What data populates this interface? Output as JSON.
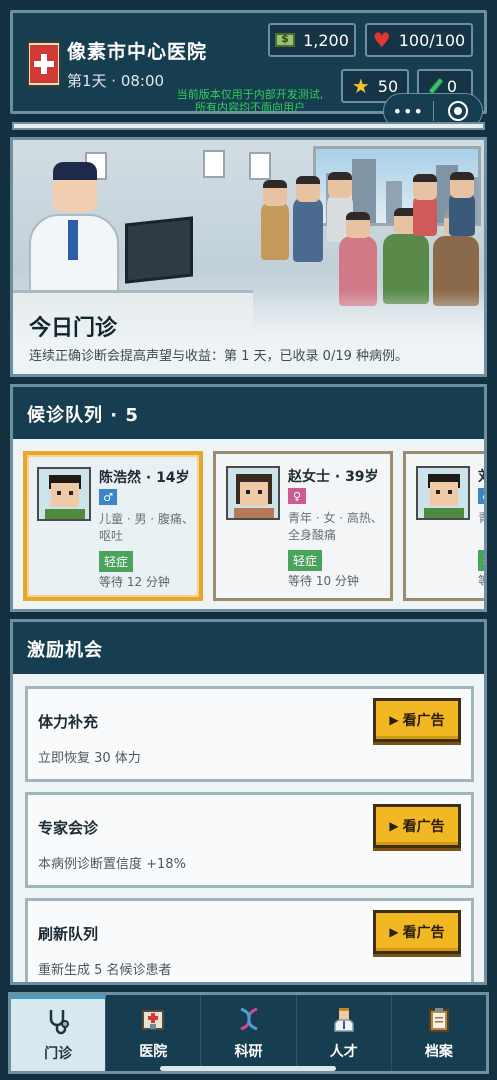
{
  "header": {
    "hospital_name": "像素市中心医院",
    "day_time": "第1天 · 08:00",
    "money": "1,200",
    "health": "100/100",
    "reputation": "50",
    "research": "0",
    "dev_notice": "当前版本仅用于内部开发测试,\n所有内容均不面向用户",
    "capsule_more": "•••"
  },
  "scene": {
    "title": "今日门诊",
    "description": "连续正确诊断会提高声望与收益：第 1 天，已收录 0/19 种病例。"
  },
  "queue": {
    "title": "候诊队列 · 5",
    "patients": [
      {
        "name": "陈浩然 · 14岁",
        "gender": "♂",
        "symptoms": "儿童 · 男 · 腹痛、呕吐",
        "severity": "轻症",
        "wait": "等待 12 分钟"
      },
      {
        "name": "赵女士 · 39岁",
        "gender": "♀",
        "symptoms": "青年 · 女 · 高热、全身酸痛",
        "severity": "轻症",
        "wait": "等待 10 分钟"
      },
      {
        "name": "刘",
        "gender": "♂",
        "symptoms": "青嗄",
        "severity": "轻",
        "wait": "等"
      }
    ]
  },
  "incentives": {
    "title": "激励机会",
    "ad_label": "看广告",
    "offers": [
      {
        "name": "体力补充",
        "desc": "立即恢复 30 体力"
      },
      {
        "name": "专家会诊",
        "desc": "本病例诊断置信度 +18%"
      },
      {
        "name": "刷新队列",
        "desc": "重新生成 5 名候诊患者"
      }
    ]
  },
  "nav": {
    "items": [
      {
        "label": "门诊",
        "icon": "stethoscope-icon"
      },
      {
        "label": "医院",
        "icon": "hospital-icon"
      },
      {
        "label": "科研",
        "icon": "dna-icon"
      },
      {
        "label": "人才",
        "icon": "doctor-icon"
      },
      {
        "label": "档案",
        "icon": "clipboard-icon"
      }
    ]
  },
  "colors": {
    "panel": "#173d50",
    "accent_gold": "#f2b824",
    "active_border": "#e8a62c",
    "severity_green": "#4aa35a"
  }
}
